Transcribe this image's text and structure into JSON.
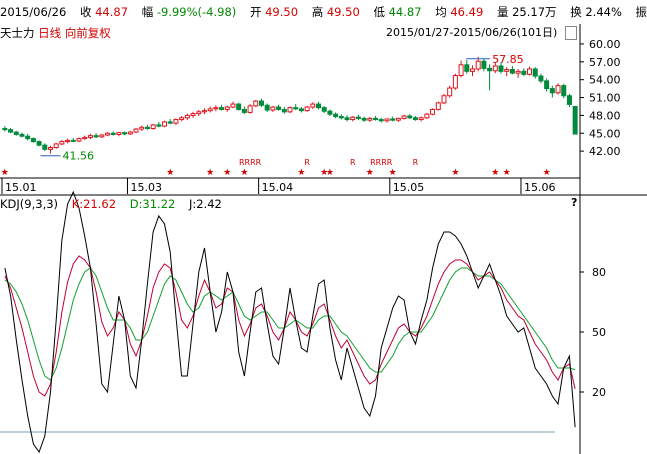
{
  "header": {
    "date": "2015/06/26",
    "close_label": "收",
    "close": "44.87",
    "change_label": "幅",
    "change": "-9.99%(-4.98)",
    "open_label": "开",
    "open": "49.50",
    "high_label": "高",
    "high": "49.50",
    "low_label": "低",
    "low": "44.87",
    "avg_label": "均",
    "avg": "46.49",
    "volume_label": "量",
    "volume": "25.17万",
    "turnover_label": "换",
    "turnover": "2.44%",
    "amplitude_label": "振"
  },
  "sub": {
    "stock_name": "天士力",
    "period": "日线",
    "adjust": "向前复权"
  },
  "colors": {
    "up": "#e0141e",
    "down": "#008a3c",
    "k": "#c00030",
    "d": "#10a030",
    "j": "#000000",
    "grid": "#7a9a7a"
  },
  "chart_data": {
    "type": "candlestick",
    "range_label": "2015/01/27-2015/06/26(101日)",
    "price_axis": {
      "ticks": [
        60.0,
        57.0,
        54.0,
        51.0,
        48.0,
        45.0,
        42.0
      ],
      "labels": [
        "60.00",
        "57.00",
        "54.00",
        "51.00",
        "48.00",
        "45.00",
        "42.00"
      ],
      "ylim": [
        39.5,
        61.0
      ]
    },
    "annotations": {
      "high": "57.85",
      "low": "41.56"
    },
    "date_labels": [
      "15.01",
      "15.03",
      "15.04",
      "15.05",
      "15.06"
    ],
    "date_label_index": [
      0,
      22,
      45,
      68,
      91
    ],
    "candles": [
      [
        45.8,
        46.2,
        45.3,
        45.6
      ],
      [
        45.6,
        45.9,
        45.0,
        45.2
      ],
      [
        45.2,
        45.4,
        44.6,
        44.8
      ],
      [
        44.8,
        45.1,
        44.3,
        44.5
      ],
      [
        44.5,
        44.9,
        43.8,
        44.1
      ],
      [
        44.1,
        44.3,
        43.4,
        43.6
      ],
      [
        43.6,
        43.8,
        42.8,
        43.0
      ],
      [
        43.0,
        43.3,
        42.0,
        42.3
      ],
      [
        42.3,
        42.9,
        41.56,
        42.6
      ],
      [
        42.6,
        43.4,
        42.4,
        43.2
      ],
      [
        43.2,
        43.9,
        43.0,
        43.6
      ],
      [
        43.6,
        44.1,
        43.3,
        43.8
      ],
      [
        43.8,
        44.2,
        43.5,
        43.7
      ],
      [
        43.7,
        44.3,
        43.5,
        44.1
      ],
      [
        44.1,
        44.6,
        43.9,
        44.3
      ],
      [
        44.3,
        44.9,
        44.0,
        44.6
      ],
      [
        44.6,
        45.0,
        44.2,
        44.4
      ],
      [
        44.4,
        44.9,
        44.2,
        44.7
      ],
      [
        44.7,
        45.2,
        44.5,
        45.0
      ],
      [
        45.0,
        45.3,
        44.6,
        44.8
      ],
      [
        44.8,
        45.2,
        44.5,
        45.1
      ],
      [
        45.1,
        45.3,
        44.7,
        44.9
      ],
      [
        44.9,
        45.4,
        44.7,
        45.2
      ],
      [
        45.2,
        45.9,
        45.0,
        45.7
      ],
      [
        45.7,
        46.3,
        45.4,
        46.0
      ],
      [
        46.0,
        46.4,
        45.6,
        45.8
      ],
      [
        45.8,
        46.6,
        45.6,
        46.4
      ],
      [
        46.4,
        46.9,
        46.0,
        46.2
      ],
      [
        46.2,
        47.1,
        46.0,
        46.9
      ],
      [
        46.9,
        47.4,
        46.5,
        46.7
      ],
      [
        46.7,
        47.5,
        46.4,
        47.3
      ],
      [
        47.3,
        47.9,
        47.0,
        47.6
      ],
      [
        47.6,
        48.3,
        47.2,
        48.0
      ],
      [
        48.0,
        48.6,
        47.6,
        48.3
      ],
      [
        48.3,
        48.9,
        47.9,
        48.6
      ],
      [
        48.6,
        49.2,
        48.2,
        48.8
      ],
      [
        48.8,
        49.5,
        48.5,
        49.1
      ],
      [
        49.1,
        49.7,
        48.7,
        49.3
      ],
      [
        49.3,
        49.8,
        48.8,
        49.0
      ],
      [
        49.0,
        49.6,
        48.6,
        49.4
      ],
      [
        49.4,
        50.3,
        49.2,
        49.9
      ],
      [
        49.9,
        50.1,
        48.8,
        49.0
      ],
      [
        49.0,
        49.5,
        48.2,
        48.5
      ],
      [
        48.5,
        49.9,
        48.3,
        49.6
      ],
      [
        49.6,
        50.6,
        49.4,
        50.4
      ],
      [
        50.4,
        50.8,
        49.4,
        49.7
      ],
      [
        49.7,
        50.0,
        48.6,
        48.9
      ],
      [
        48.9,
        49.6,
        48.6,
        49.4
      ],
      [
        49.4,
        49.8,
        48.8,
        49.0
      ],
      [
        49.0,
        49.4,
        48.3,
        48.6
      ],
      [
        48.6,
        49.5,
        48.4,
        49.3
      ],
      [
        49.3,
        49.9,
        48.9,
        49.1
      ],
      [
        49.1,
        49.4,
        48.5,
        48.8
      ],
      [
        48.8,
        49.6,
        48.6,
        49.4
      ],
      [
        49.4,
        50.2,
        49.1,
        49.9
      ],
      [
        49.9,
        50.3,
        49.0,
        49.3
      ],
      [
        49.3,
        49.6,
        48.4,
        48.7
      ],
      [
        48.7,
        49.0,
        47.9,
        48.2
      ],
      [
        48.2,
        48.5,
        47.5,
        47.8
      ],
      [
        47.8,
        48.2,
        47.3,
        47.6
      ],
      [
        47.6,
        48.0,
        47.0,
        47.3
      ],
      [
        47.3,
        47.9,
        47.0,
        47.7
      ],
      [
        47.7,
        48.1,
        47.2,
        47.5
      ],
      [
        47.5,
        47.8,
        46.9,
        47.2
      ],
      [
        47.2,
        47.7,
        46.9,
        47.5
      ],
      [
        47.5,
        47.9,
        47.1,
        47.3
      ],
      [
        47.3,
        47.6,
        46.8,
        47.1
      ],
      [
        47.1,
        47.5,
        46.8,
        47.4
      ],
      [
        47.4,
        47.8,
        47.0,
        47.2
      ],
      [
        47.2,
        47.6,
        46.9,
        47.5
      ],
      [
        47.5,
        48.1,
        47.3,
        47.9
      ],
      [
        47.9,
        48.2,
        47.4,
        47.6
      ],
      [
        47.6,
        47.9,
        47.1,
        47.3
      ],
      [
        47.3,
        47.8,
        47.0,
        47.6
      ],
      [
        47.6,
        48.4,
        47.4,
        48.2
      ],
      [
        48.2,
        49.2,
        48.0,
        49.0
      ],
      [
        49.0,
        50.3,
        48.8,
        50.1
      ],
      [
        50.1,
        51.6,
        49.9,
        51.3
      ],
      [
        51.3,
        53.0,
        51.0,
        52.6
      ],
      [
        52.6,
        55.0,
        52.3,
        54.7
      ],
      [
        54.7,
        57.2,
        54.4,
        56.5
      ],
      [
        56.5,
        57.3,
        55.0,
        55.4
      ],
      [
        55.4,
        56.4,
        54.6,
        55.8
      ],
      [
        55.8,
        57.85,
        55.4,
        57.1
      ],
      [
        57.1,
        57.6,
        55.4,
        55.9
      ],
      [
        55.9,
        56.6,
        52.2,
        55.5
      ],
      [
        55.5,
        56.8,
        55.1,
        56.3
      ],
      [
        56.3,
        56.9,
        55.0,
        55.4
      ],
      [
        55.4,
        56.1,
        54.6,
        55.7
      ],
      [
        55.7,
        56.3,
        54.9,
        55.1
      ],
      [
        55.1,
        55.8,
        54.3,
        55.4
      ],
      [
        55.4,
        55.9,
        54.6,
        54.9
      ],
      [
        54.9,
        56.2,
        54.7,
        55.8
      ],
      [
        55.8,
        56.1,
        54.2,
        54.6
      ],
      [
        54.6,
        55.0,
        53.4,
        53.8
      ],
      [
        53.8,
        54.2,
        52.0,
        52.5
      ],
      [
        52.5,
        53.0,
        51.0,
        51.8
      ],
      [
        51.8,
        53.4,
        51.5,
        53.0
      ],
      [
        53.0,
        53.3,
        50.9,
        51.3
      ],
      [
        51.3,
        51.6,
        49.4,
        49.85
      ],
      [
        49.5,
        49.5,
        44.87,
        44.87
      ]
    ],
    "markers": [
      {
        "i": 0,
        "t": "★"
      },
      {
        "i": 29,
        "t": "★"
      },
      {
        "i": 36,
        "t": "★"
      },
      {
        "i": 39,
        "t": "★"
      },
      {
        "i": 42,
        "t": "★"
      },
      {
        "i": 43,
        "t": "RRRR"
      },
      {
        "i": 52,
        "t": "★"
      },
      {
        "i": 53,
        "t": "R"
      },
      {
        "i": 56,
        "t": "★"
      },
      {
        "i": 57,
        "t": "★"
      },
      {
        "i": 61,
        "t": "R"
      },
      {
        "i": 64,
        "t": "★"
      },
      {
        "i": 66,
        "t": "RRRR"
      },
      {
        "i": 68,
        "t": "★"
      },
      {
        "i": 72,
        "t": "R"
      },
      {
        "i": 79,
        "t": "★"
      },
      {
        "i": 86,
        "t": "★"
      },
      {
        "i": 88,
        "t": "★"
      },
      {
        "i": 95,
        "t": "★"
      }
    ],
    "kdj": {
      "title": "KDJ(9,3,3)",
      "k_text": "K:21.62",
      "d_text": "D:31.22",
      "j_text": "J:2.42",
      "help": "?",
      "axis_ticks": [
        80,
        50,
        20
      ],
      "ylim": [
        -10,
        110
      ],
      "k": [
        78,
        72,
        62,
        52,
        40,
        28,
        20,
        18,
        24,
        40,
        60,
        75,
        84,
        88,
        86,
        82,
        70,
        55,
        48,
        52,
        60,
        56,
        44,
        38,
        46,
        58,
        72,
        80,
        84,
        82,
        70,
        56,
        52,
        58,
        68,
        76,
        70,
        62,
        64,
        72,
        70,
        56,
        48,
        54,
        62,
        64,
        58,
        50,
        46,
        52,
        60,
        56,
        50,
        48,
        54,
        62,
        64,
        56,
        48,
        42,
        46,
        40,
        34,
        28,
        24,
        26,
        34,
        40,
        46,
        52,
        54,
        50,
        48,
        52,
        58,
        66,
        74,
        80,
        84,
        86,
        86,
        84,
        80,
        76,
        78,
        80,
        76,
        72,
        66,
        62,
        58,
        56,
        50,
        44,
        40,
        36,
        30,
        26,
        32,
        34,
        21.62
      ],
      "d": [
        76,
        74,
        70,
        64,
        56,
        46,
        36,
        28,
        26,
        32,
        42,
        54,
        66,
        74,
        80,
        82,
        78,
        70,
        62,
        56,
        56,
        56,
        52,
        46,
        46,
        50,
        58,
        66,
        74,
        78,
        76,
        70,
        64,
        60,
        62,
        68,
        70,
        68,
        66,
        68,
        70,
        64,
        58,
        56,
        58,
        60,
        60,
        56,
        52,
        52,
        54,
        56,
        54,
        52,
        52,
        56,
        58,
        58,
        54,
        50,
        48,
        44,
        40,
        36,
        32,
        30,
        30,
        34,
        38,
        44,
        48,
        50,
        50,
        50,
        54,
        58,
        64,
        70,
        76,
        80,
        82,
        82,
        80,
        78,
        78,
        78,
        76,
        74,
        70,
        66,
        62,
        58,
        54,
        50,
        46,
        42,
        36,
        32,
        32,
        32,
        31.22
      ],
      "j": [
        82,
        68,
        46,
        26,
        8,
        -6,
        -10,
        -2,
        20,
        56,
        96,
        114,
        120,
        112,
        98,
        82,
        54,
        24,
        20,
        44,
        68,
        56,
        28,
        22,
        46,
        74,
        100,
        108,
        104,
        90,
        58,
        28,
        28,
        54,
        80,
        92,
        70,
        50,
        60,
        80,
        70,
        40,
        28,
        50,
        70,
        72,
        54,
        38,
        34,
        52,
        72,
        56,
        42,
        40,
        58,
        74,
        76,
        52,
        36,
        26,
        42,
        32,
        22,
        12,
        8,
        18,
        42,
        52,
        62,
        68,
        66,
        50,
        44,
        56,
        66,
        82,
        94,
        100,
        100,
        98,
        94,
        88,
        80,
        72,
        78,
        84,
        76,
        68,
        58,
        54,
        50,
        52,
        42,
        32,
        28,
        24,
        18,
        14,
        32,
        38,
        2.42
      ]
    }
  }
}
